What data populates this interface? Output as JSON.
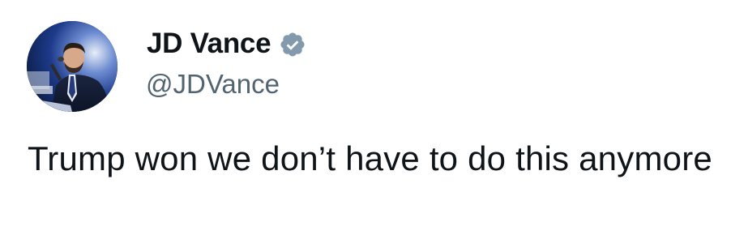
{
  "author": {
    "display_name": "JD Vance",
    "handle": "@JDVance",
    "verified": true,
    "verified_icon": "verified-badge-icon"
  },
  "tweet": {
    "text": "Trump won we don’t have to do this anymore"
  },
  "colors": {
    "text_primary": "#0f1419",
    "text_secondary": "#536471",
    "verified_blue": "#829aab",
    "background": "#ffffff"
  }
}
